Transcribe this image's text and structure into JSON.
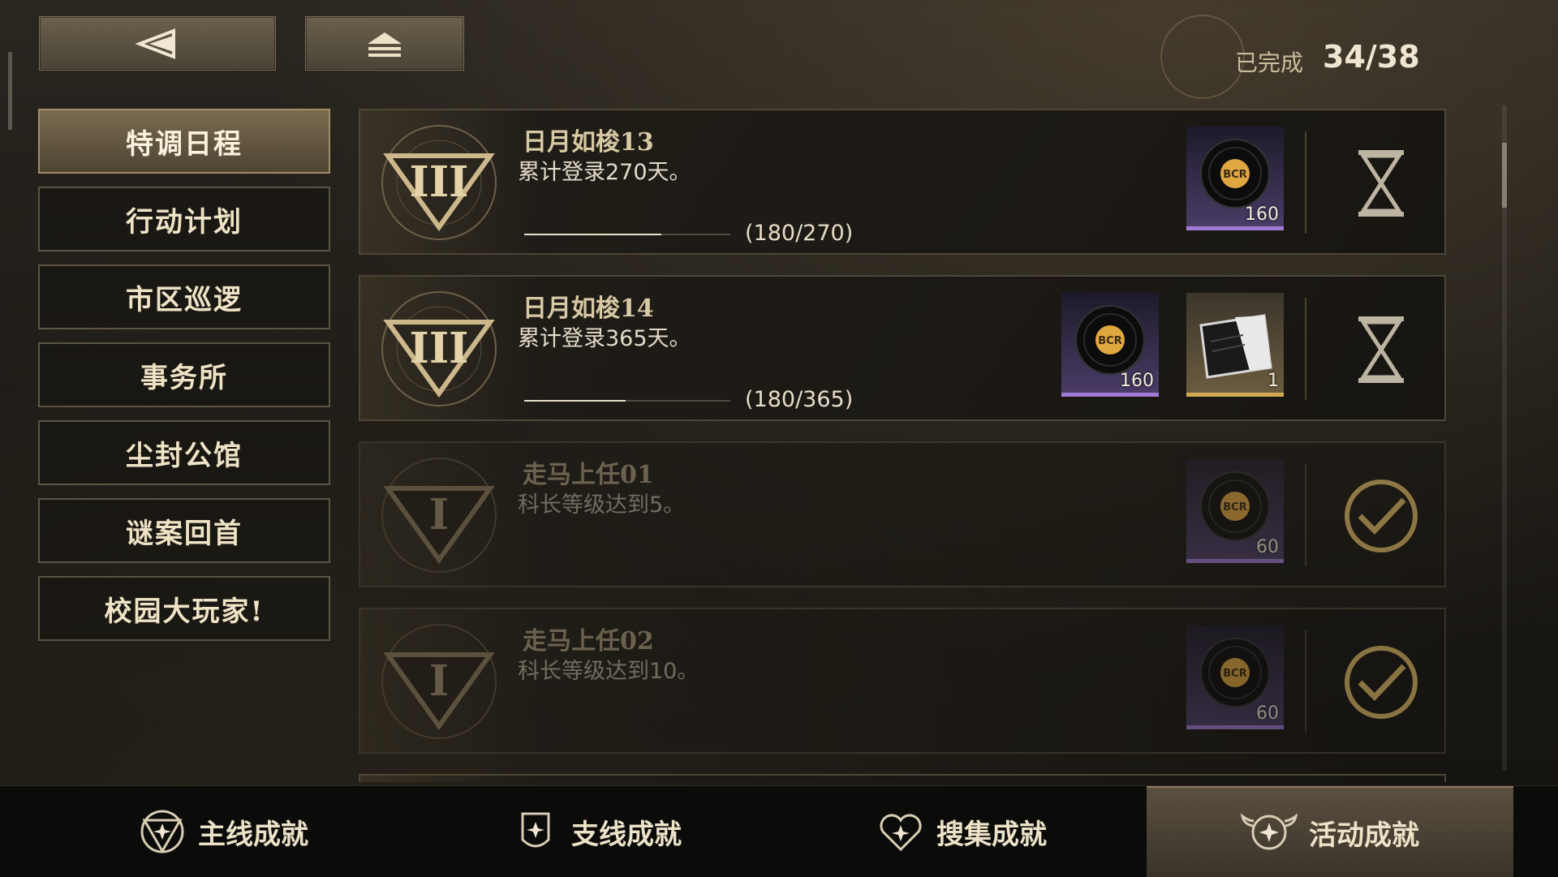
{
  "header": {
    "completed_label": "已完成",
    "completed_count": "34/38"
  },
  "icons": {
    "back": "back-arrow-icon",
    "home": "home-icon",
    "pending": "hourglass-icon",
    "done": "checkmark-icon"
  },
  "colors": {
    "accent_gold": "#d0aa55",
    "rarity_purple": "#a07ad6"
  },
  "sidebar": {
    "items": [
      {
        "label": "特调日程",
        "active": true
      },
      {
        "label": "行动计划",
        "active": false
      },
      {
        "label": "市区巡逻",
        "active": false
      },
      {
        "label": "事务所",
        "active": false
      },
      {
        "label": "尘封公馆",
        "active": false
      },
      {
        "label": "谜案回首",
        "active": false
      },
      {
        "label": "校园大玩家!",
        "active": false
      }
    ]
  },
  "achievements": [
    {
      "title": "日月如梭13",
      "description": "累计登录270天。",
      "badge_numeral": "III",
      "progress_text": "(180/270)",
      "progress_fraction": 0.667,
      "status": "in-progress",
      "rewards": [
        {
          "item": "record-disc-icon",
          "quantity": "160",
          "rarity": "purple"
        }
      ]
    },
    {
      "title": "日月如梭14",
      "description": "累计登录365天。",
      "badge_numeral": "III",
      "progress_text": "(180/365)",
      "progress_fraction": 0.493,
      "status": "in-progress",
      "rewards": [
        {
          "item": "record-disc-icon",
          "quantity": "160",
          "rarity": "purple"
        },
        {
          "item": "envelope-card-icon",
          "quantity": "1",
          "rarity": "gold"
        }
      ]
    },
    {
      "title": "走马上任01",
      "description": "科长等级达到5。",
      "badge_numeral": "I",
      "progress_text": "",
      "progress_fraction": 1,
      "status": "completed",
      "rewards": [
        {
          "item": "record-disc-icon",
          "quantity": "60",
          "rarity": "purple"
        }
      ]
    },
    {
      "title": "走马上任02",
      "description": "科长等级达到10。",
      "badge_numeral": "I",
      "progress_text": "",
      "progress_fraction": 1,
      "status": "completed",
      "rewards": [
        {
          "item": "record-disc-icon",
          "quantity": "60",
          "rarity": "purple"
        }
      ]
    }
  ],
  "bottom_tabs": [
    {
      "label": "主线成就",
      "icon": "triangle-star-icon",
      "active": false
    },
    {
      "label": "支线成就",
      "icon": "shield-star-icon",
      "active": false
    },
    {
      "label": "搜集成就",
      "icon": "heart-star-icon",
      "active": false
    },
    {
      "label": "活动成就",
      "icon": "winged-star-icon",
      "active": true
    }
  ]
}
